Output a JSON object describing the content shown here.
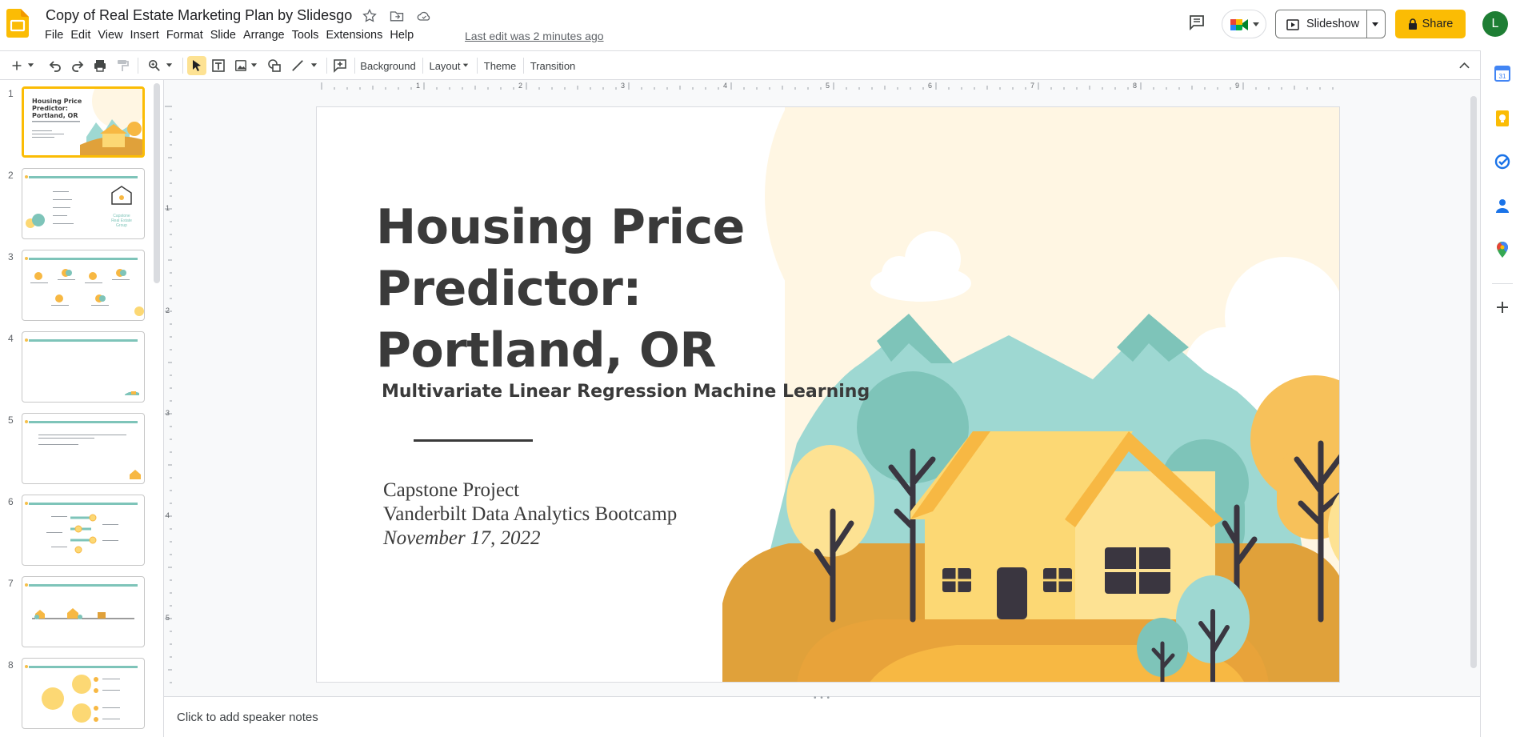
{
  "app": {
    "doc_title": "Copy of Real Estate Marketing Plan by Slidesgo",
    "last_edit": "Last edit was 2 minutes ago",
    "brand_color": "#fbbc04"
  },
  "menu": [
    "File",
    "Edit",
    "View",
    "Insert",
    "Format",
    "Slide",
    "Arrange",
    "Tools",
    "Extensions",
    "Help"
  ],
  "header_buttons": {
    "slideshow_label": "Slideshow",
    "share_label": "Share",
    "avatar_initial": "L"
  },
  "toolbar": {
    "background_label": "Background",
    "layout_label": "Layout",
    "theme_label": "Theme",
    "transition_label": "Transition"
  },
  "filmstrip": {
    "slides": [
      {
        "number": "1",
        "selected": true
      },
      {
        "number": "2",
        "selected": false
      },
      {
        "number": "3",
        "selected": false
      },
      {
        "number": "4",
        "selected": false
      },
      {
        "number": "5",
        "selected": false
      },
      {
        "number": "6",
        "selected": false
      },
      {
        "number": "7",
        "selected": false
      },
      {
        "number": "8",
        "selected": false
      }
    ]
  },
  "ruler": {
    "top_ticks": [
      "1",
      "2",
      "3",
      "4",
      "5",
      "6",
      "7",
      "8",
      "9"
    ],
    "left_ticks": [
      "1",
      "2",
      "3",
      "4",
      "5"
    ]
  },
  "slide": {
    "title": "Housing Price\nPredictor:\nPortland, OR",
    "subtitle": "Multivariate Linear Regression Machine Learning",
    "project": "Capstone Project",
    "program": "Vanderbilt Data Analytics Bootcamp",
    "date": "November 17, 2022"
  },
  "notes": {
    "placeholder": "Click to add speaker notes"
  },
  "colors": {
    "teal": "#7ec4b9",
    "light_teal": "#9ed8d2",
    "house_yellow": "#fcd874",
    "orange": "#f7b843",
    "ground": "#e0a13a",
    "dark": "#3a3640",
    "cream": "#fff6e3"
  }
}
